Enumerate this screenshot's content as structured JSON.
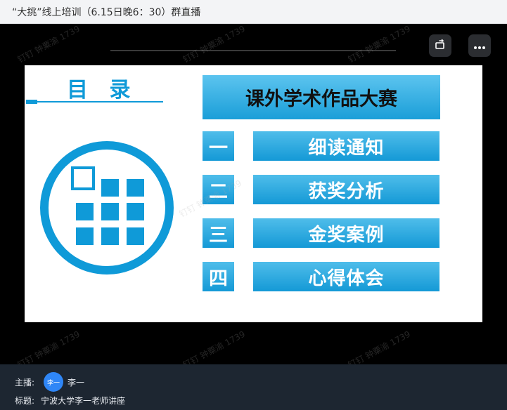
{
  "window": {
    "title": "“大挑”线上培训（6.15日晚6：30）群直播"
  },
  "controls": {
    "rotate_icon": "rotate-screen-icon",
    "more_icon": "more-dots-icon"
  },
  "slide": {
    "toc_heading": "目 录",
    "competition_title": "课外学术作品大赛",
    "items": [
      {
        "number": "一",
        "label": "细读通知"
      },
      {
        "number": "二",
        "label": "获奖分析"
      },
      {
        "number": "三",
        "label": "金奖案例"
      },
      {
        "number": "四",
        "label": "心得体会"
      }
    ],
    "accent_color": "#0f9ad8"
  },
  "watermark": {
    "text": "钉钉  钟粟渝 1739"
  },
  "footer": {
    "host_label": "主播:",
    "host_avatar_text": "李一",
    "host_name": "李一",
    "topic_label": "标题:",
    "topic": "宁波大学李一老师讲座"
  }
}
